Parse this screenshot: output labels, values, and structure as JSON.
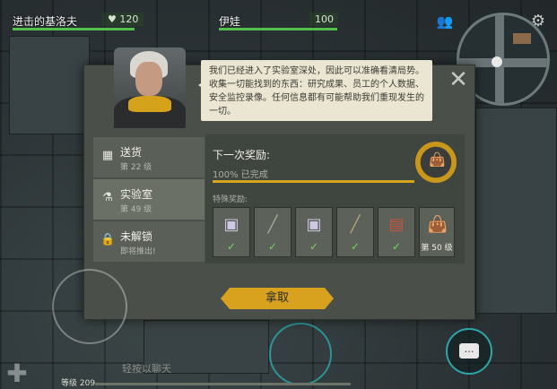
{
  "hud": {
    "player_name": "进击的基洛夫",
    "player_health": "120",
    "companion_name": "伊娃",
    "companion_health": "100"
  },
  "dialog": {
    "text": "我们已经进入了实验室深处，因此可以准确看清局势。收集一切能找到的东西：研究成果、员工的个人数据、安全监控录像。任何信息都有可能帮助我们重现发生的一切。"
  },
  "sidebar": {
    "items": [
      {
        "title": "送货",
        "subtitle": "第 22 级",
        "icon": "crates-icon"
      },
      {
        "title": "实验室",
        "subtitle": "第 49 级",
        "icon": "flask-icon"
      },
      {
        "title": "未解锁",
        "subtitle": "即将推出!",
        "icon": "lock-icon"
      }
    ]
  },
  "reward": {
    "next_label": "下一次奖励:",
    "progress_text": "100% 已完成",
    "progress_percent": 100,
    "special_label": "特殊奖励:",
    "cards": [
      {
        "icon": "data-chip-icon",
        "status": "✓"
      },
      {
        "icon": "rifle-icon",
        "status": "✓"
      },
      {
        "icon": "data-chip-icon",
        "status": "✓"
      },
      {
        "icon": "shotgun-icon",
        "status": "✓"
      },
      {
        "icon": "backpack-icon",
        "status": "✓"
      },
      {
        "icon": "loot-bag-icon",
        "level": "第 50 级"
      }
    ]
  },
  "claim_label": "拿取",
  "bottom": {
    "level_label": "等级 209",
    "chat_placeholder": "轻按以聊天"
  },
  "colors": {
    "accent": "#d8a21e",
    "health": "#54c04c",
    "check": "#77d163",
    "teal": "#2ea6a8"
  }
}
